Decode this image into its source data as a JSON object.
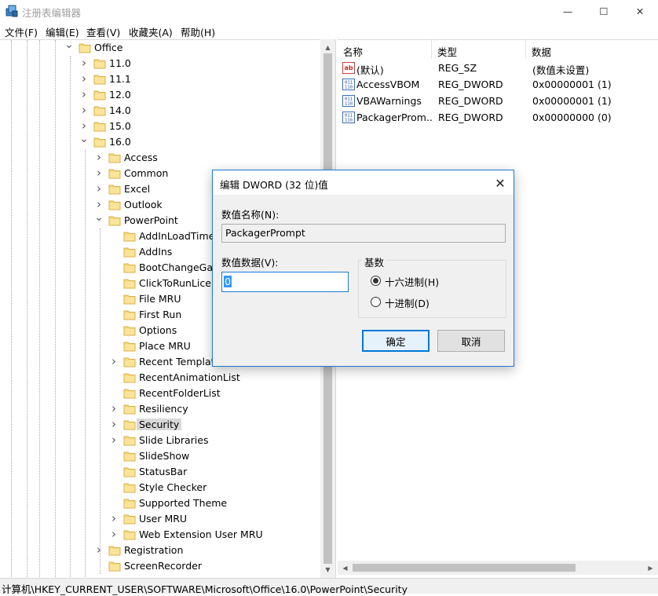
{
  "window": {
    "title": "注册表编辑器",
    "minimize_glyph": "—",
    "maximize_glyph": "☐",
    "close_glyph": "✕"
  },
  "menu": [
    "文件(F)",
    "编辑(E)",
    "查看(V)",
    "收藏夹(A)",
    "帮助(H)"
  ],
  "tree": {
    "rows": [
      {
        "label": "Office",
        "depth": 0,
        "expanded": true,
        "has_children": true
      },
      {
        "label": "11.0",
        "depth": 1,
        "expanded": false,
        "has_children": true
      },
      {
        "label": "11.1",
        "depth": 1,
        "expanded": false,
        "has_children": true
      },
      {
        "label": "12.0",
        "depth": 1,
        "expanded": false,
        "has_children": true
      },
      {
        "label": "14.0",
        "depth": 1,
        "expanded": false,
        "has_children": true
      },
      {
        "label": "15.0",
        "depth": 1,
        "expanded": false,
        "has_children": true
      },
      {
        "label": "16.0",
        "depth": 1,
        "expanded": true,
        "has_children": true
      },
      {
        "label": "Access",
        "depth": 2,
        "expanded": false,
        "has_children": true
      },
      {
        "label": "Common",
        "depth": 2,
        "expanded": false,
        "has_children": true
      },
      {
        "label": "Excel",
        "depth": 2,
        "expanded": false,
        "has_children": true
      },
      {
        "label": "Outlook",
        "depth": 2,
        "expanded": false,
        "has_children": true
      },
      {
        "label": "PowerPoint",
        "depth": 2,
        "expanded": true,
        "has_children": true
      },
      {
        "label": "AddInLoadTimes",
        "depth": 3,
        "expanded": false,
        "has_children": false
      },
      {
        "label": "AddIns",
        "depth": 3,
        "expanded": false,
        "has_children": false
      },
      {
        "label": "BootChangeGate",
        "depth": 3,
        "expanded": false,
        "has_children": false
      },
      {
        "label": "ClickToRunLicensing",
        "depth": 3,
        "expanded": false,
        "has_children": false
      },
      {
        "label": "File MRU",
        "depth": 3,
        "expanded": false,
        "has_children": false
      },
      {
        "label": "First Run",
        "depth": 3,
        "expanded": false,
        "has_children": false
      },
      {
        "label": "Options",
        "depth": 3,
        "expanded": false,
        "has_children": false
      },
      {
        "label": "Place MRU",
        "depth": 3,
        "expanded": false,
        "has_children": false
      },
      {
        "label": "Recent Templates",
        "depth": 3,
        "expanded": false,
        "has_children": true
      },
      {
        "label": "RecentAnimationList",
        "depth": 3,
        "expanded": false,
        "has_children": false
      },
      {
        "label": "RecentFolderList",
        "depth": 3,
        "expanded": false,
        "has_children": false
      },
      {
        "label": "Resiliency",
        "depth": 3,
        "expanded": false,
        "has_children": true
      },
      {
        "label": "Security",
        "depth": 3,
        "expanded": false,
        "has_children": true,
        "selected": true
      },
      {
        "label": "Slide Libraries",
        "depth": 3,
        "expanded": false,
        "has_children": true
      },
      {
        "label": "SlideShow",
        "depth": 3,
        "expanded": false,
        "has_children": false
      },
      {
        "label": "StatusBar",
        "depth": 3,
        "expanded": false,
        "has_children": false
      },
      {
        "label": "Style Checker",
        "depth": 3,
        "expanded": false,
        "has_children": false
      },
      {
        "label": "Supported Theme",
        "depth": 3,
        "expanded": false,
        "has_children": false
      },
      {
        "label": "User MRU",
        "depth": 3,
        "expanded": false,
        "has_children": true
      },
      {
        "label": "Web Extension User MRU",
        "depth": 3,
        "expanded": false,
        "has_children": true
      },
      {
        "label": "Registration",
        "depth": 2,
        "expanded": false,
        "has_children": true
      },
      {
        "label": "ScreenRecorder",
        "depth": 2,
        "expanded": false,
        "has_children": false
      }
    ]
  },
  "values": {
    "columns": [
      "名称",
      "类型",
      "数据"
    ],
    "rows": [
      {
        "name": "(默认)",
        "type": "REG_SZ",
        "data": "(数值未设置)",
        "icon": "string-value-icon"
      },
      {
        "name": "AccessVBOM",
        "type": "REG_DWORD",
        "data": "0x00000001 (1)",
        "icon": "dword-value-icon"
      },
      {
        "name": "VBAWarnings",
        "type": "REG_DWORD",
        "data": "0x00000001 (1)",
        "icon": "dword-value-icon"
      },
      {
        "name": "PackagerProm...",
        "type": "REG_DWORD",
        "data": "0x00000000 (0)",
        "icon": "dword-value-icon"
      }
    ]
  },
  "status": {
    "path": "计算机\\HKEY_CURRENT_USER\\SOFTWARE\\Microsoft\\Office\\16.0\\PowerPoint\\Security"
  },
  "dialog": {
    "title": "编辑 DWORD (32 位)值",
    "name_label": "数值名称(N):",
    "name_value": "PackagerPrompt",
    "data_label": "数值数据(V):",
    "data_value": "0",
    "base_label": "基数",
    "radio_hex": "十六进制(H)",
    "radio_dec": "十进制(D)",
    "hex_selected": true,
    "ok": "确定",
    "cancel": "取消"
  },
  "colors": {
    "accent": "#0078d7",
    "selection": "#3399ff",
    "folder": "#f8d775"
  }
}
